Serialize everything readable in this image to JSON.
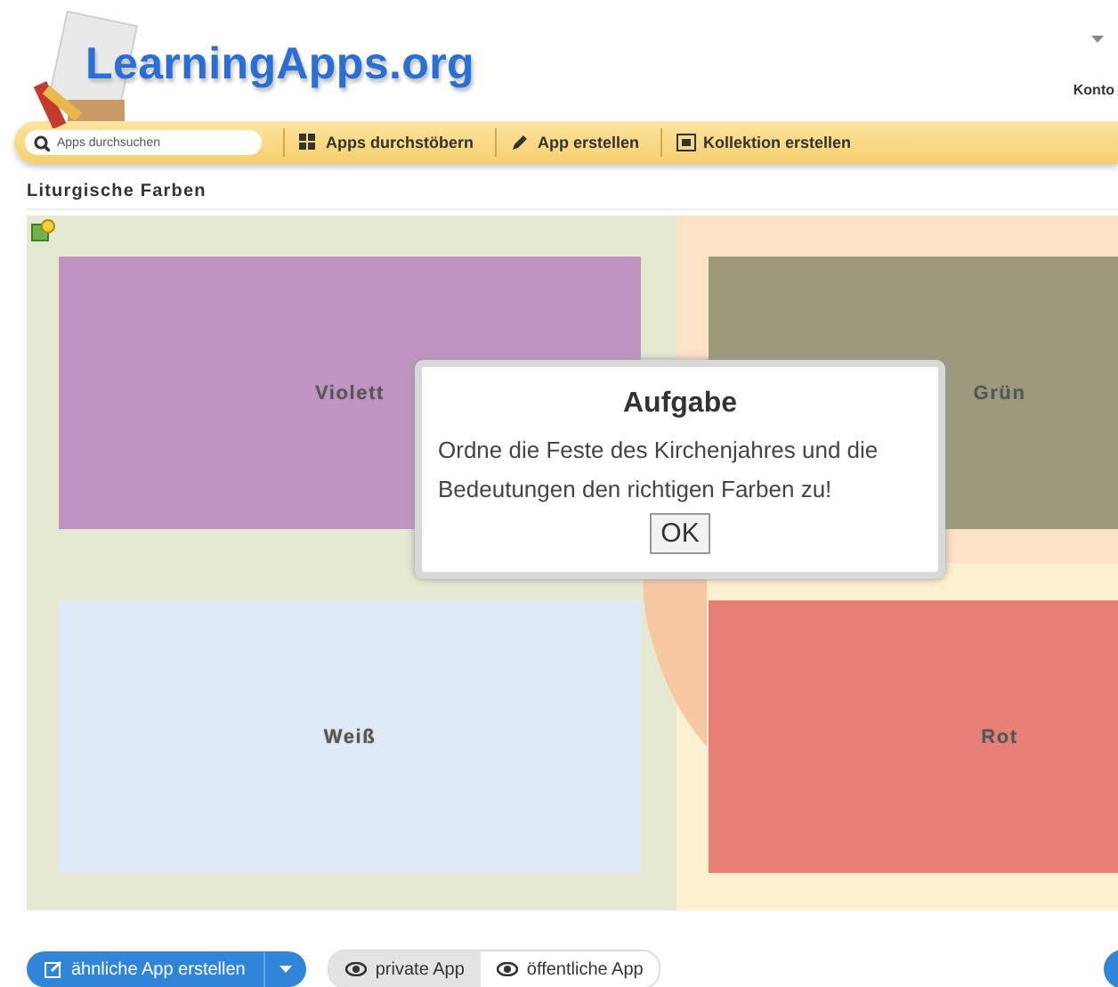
{
  "header": {
    "logo": "LearningApps.org",
    "account_menu": "Konto"
  },
  "toolbar": {
    "search": {
      "placeholder": "Apps durchsuchen"
    },
    "items": [
      {
        "label": "Apps durchstöbern",
        "kind": "grid"
      },
      {
        "label": "App erstellen",
        "kind": "pencil"
      },
      {
        "label": "Kollektion erstellen",
        "kind": "collection"
      }
    ]
  },
  "app": {
    "title": "Liturgische Farben",
    "cards": [
      {
        "label": "Violett",
        "color": "#c194c3"
      },
      {
        "label": "Grün",
        "color": "#9c9a7b"
      },
      {
        "label": "Weiß",
        "color": "#deebf6"
      },
      {
        "label": "Rot",
        "color": "#e88077"
      }
    ],
    "dialog": {
      "title": "Aufgabe",
      "message": "Ordne die Feste des Kirchenjahres und die Bedeutungen den richtigen Farben zu!",
      "button": "OK"
    }
  },
  "footer": {
    "create_button": "ähnliche App erstellen",
    "visibility": [
      {
        "label": "private App",
        "selected": true
      },
      {
        "label": "öffentliche App",
        "selected": false
      }
    ]
  }
}
